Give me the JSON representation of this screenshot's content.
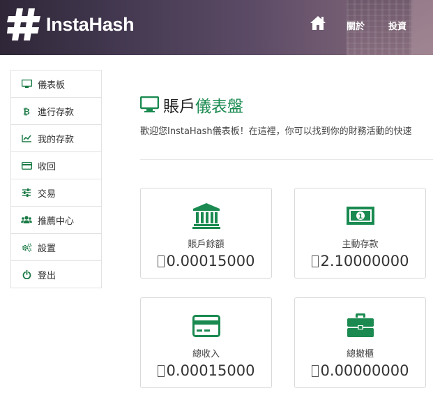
{
  "brand": {
    "name": "InstaHash"
  },
  "nav": {
    "items": [
      {
        "label": "關於"
      },
      {
        "label": "投資"
      }
    ]
  },
  "sidebar": {
    "items": [
      {
        "label": "儀表板",
        "icon": "monitor-icon"
      },
      {
        "label": "進行存款",
        "icon": "bitcoin-icon"
      },
      {
        "label": "我的存款",
        "icon": "line-chart-icon"
      },
      {
        "label": "收回",
        "icon": "credit-card-icon"
      },
      {
        "label": "交易",
        "icon": "sliders-icon"
      },
      {
        "label": "推薦中心",
        "icon": "users-icon"
      },
      {
        "label": "設置",
        "icon": "gears-icon"
      },
      {
        "label": "登出",
        "icon": "power-icon"
      }
    ]
  },
  "page": {
    "title_plain": "賬戶",
    "title_accent": "儀表盤",
    "welcome": "歡迎您InstaHash儀表板！在這裡，你可以找到你的財務活動的快速"
  },
  "cards": [
    {
      "label": "賬戶餘額",
      "value": "0.00015000",
      "icon": "bank-icon"
    },
    {
      "label": "主動存款",
      "value": "2.10000000",
      "icon": "money-icon"
    },
    {
      "label": "總收入",
      "value": "0.00015000",
      "icon": "credit-card-icon"
    },
    {
      "label": "總撤櫃",
      "value": "0.00000000",
      "icon": "briefcase-icon"
    }
  ],
  "colors": {
    "accent": "#1a8a50",
    "header": "#453a52"
  }
}
